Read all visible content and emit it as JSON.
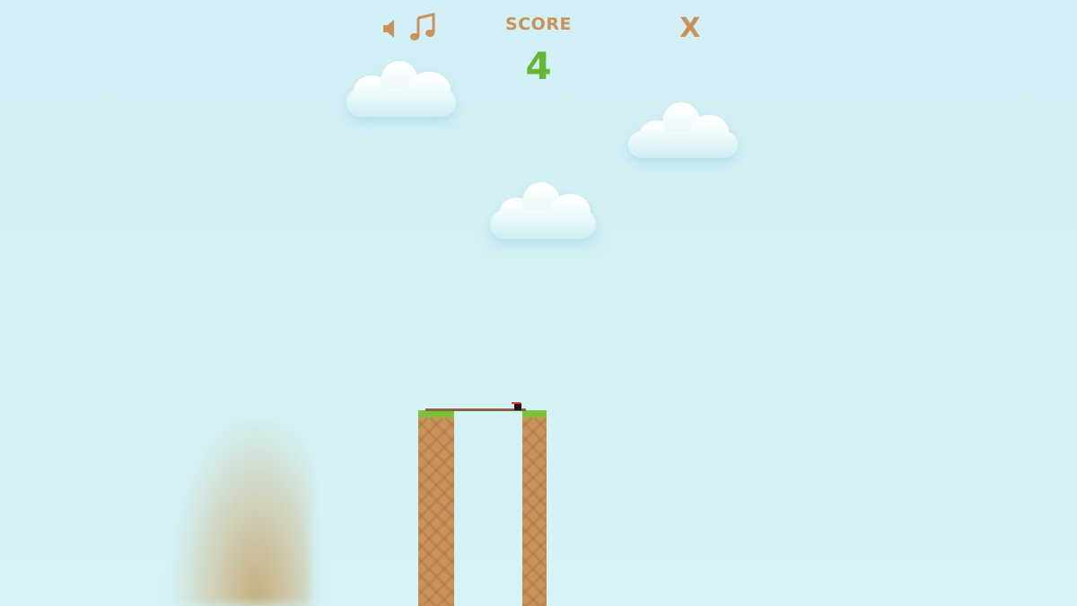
{
  "hud": {
    "score_label": "SCORE",
    "score_value": "4",
    "close_label": "X",
    "sound_icon": "speaker-icon",
    "music_icon": "music-note-icon"
  },
  "colors": {
    "sky": "#d3f1f5",
    "score_label": "#c9925b",
    "score_value": "#67b537",
    "dirt": "#c9925b",
    "grass": "#7cc13a",
    "stick": "#8a6640",
    "hero": "#1a1a1a",
    "hero_headband": "#dd3333"
  }
}
